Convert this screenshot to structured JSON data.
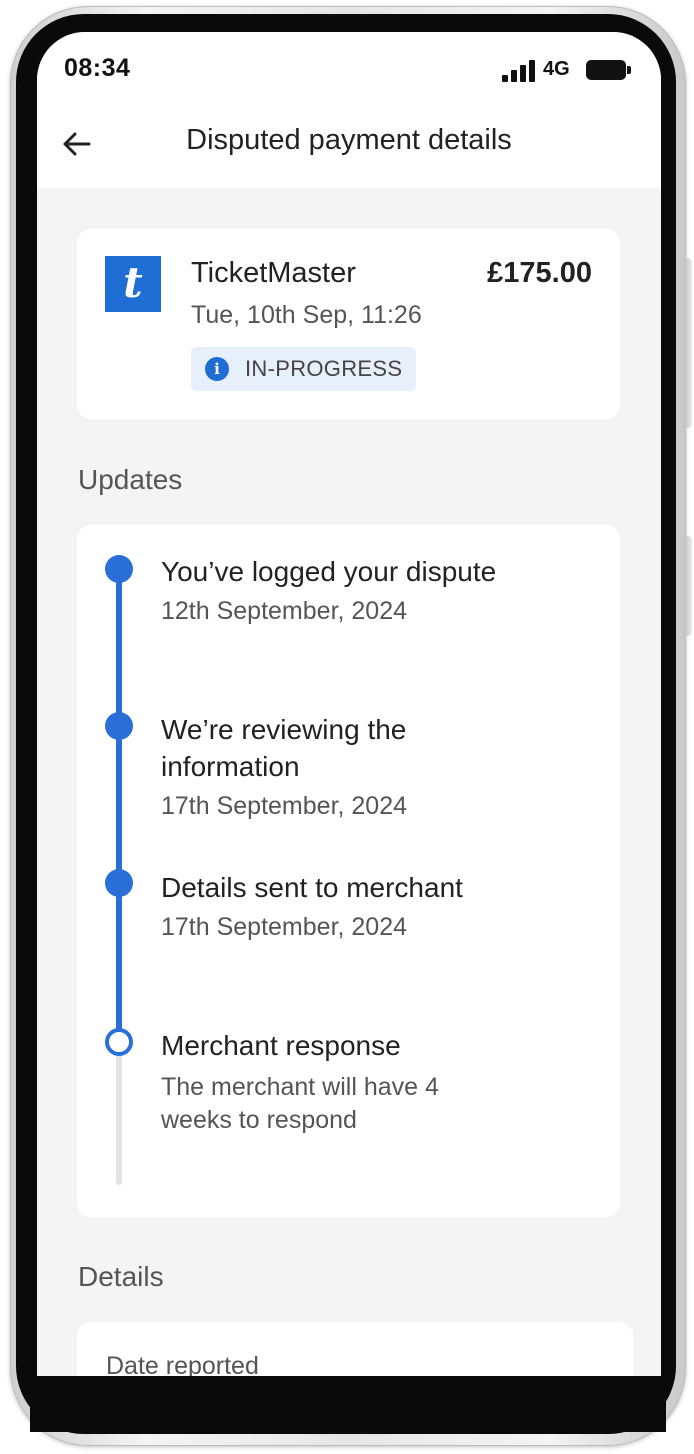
{
  "status_bar": {
    "time": "08:34",
    "network": "4G"
  },
  "header": {
    "title": "Disputed payment details"
  },
  "transaction": {
    "logo_letter": "t",
    "merchant": "TicketMaster",
    "date": "Tue, 10th Sep, 11:26",
    "amount": "£175.00",
    "status": "IN-PROGRESS",
    "info_glyph": "i"
  },
  "updates": {
    "heading": "Updates",
    "steps": [
      {
        "title": "You’ve logged your dispute",
        "subtitle": "12th September, 2024",
        "state": "complete"
      },
      {
        "title": "We’re reviewing the information",
        "subtitle": "17th September, 2024",
        "state": "complete"
      },
      {
        "title": "Details sent to merchant",
        "subtitle": "17th September, 2024",
        "state": "complete"
      },
      {
        "title": "Merchant response",
        "subtitle": "The merchant will have 4 weeks to respond",
        "state": "pending"
      }
    ]
  },
  "details": {
    "heading": "Details",
    "date_reported_label": "Date reported"
  },
  "colors": {
    "accent": "#2a6fd8",
    "merchant_brand": "#1f6ed4",
    "badge_bg": "#e6effa",
    "screen_bg": "#f4f4f4"
  },
  "icons": {
    "back": "arrow-left-icon",
    "signal": "signal-bars-icon",
    "battery": "battery-icon",
    "info": "info-icon"
  }
}
